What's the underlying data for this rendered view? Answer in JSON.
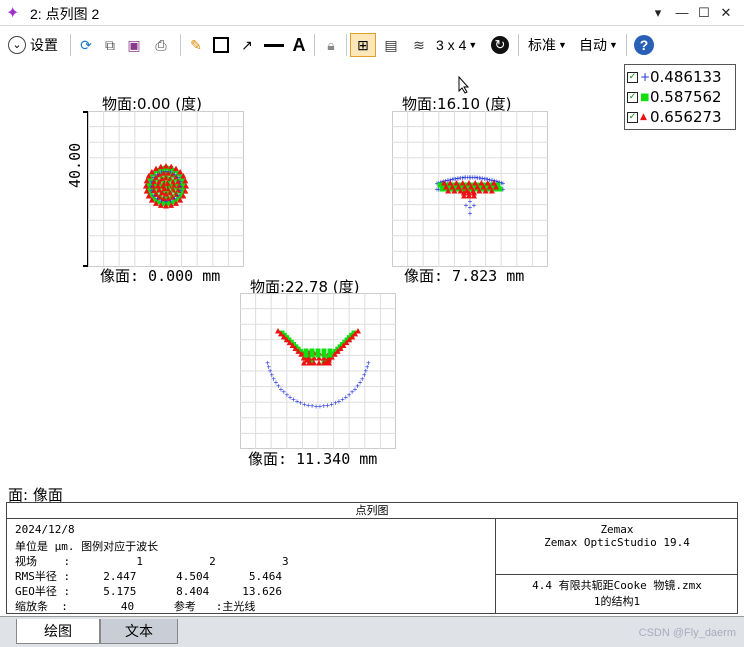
{
  "window": {
    "title": "2: 点列图 2",
    "buttons": [
      "▾",
      "—",
      "☐",
      "✕"
    ]
  },
  "toolbar": {
    "settings_label": "设置",
    "layout_label": "3 x 4",
    "standard_label": "标准",
    "auto_label": "自动"
  },
  "plots": [
    {
      "object_label": "物面:0.00 (度)",
      "image_label": "像面: 0.000 mm"
    },
    {
      "object_label": "物面:16.10 (度)",
      "image_label": "像面: 7.823 mm"
    },
    {
      "object_label": "物面:22.78 (度)",
      "image_label": "像面: 11.340 mm"
    }
  ],
  "scale_bar_label": "40.00",
  "legend": [
    {
      "value": "0.486133",
      "marker": "+",
      "color": "#2233dd"
    },
    {
      "value": "0.587562",
      "marker": "■",
      "color": "#11dd11"
    },
    {
      "value": "0.656273",
      "marker": "▲",
      "color": "#ee1111"
    }
  ],
  "surface_label": "面: 像面",
  "info": {
    "title": "点列图",
    "date": "2024/12/8",
    "units_line": "单位是 μm. 图例对应于波长",
    "field_line": "视场    :          1          2          3",
    "rms_line": "RMS半径 :     2.447      4.504      5.464",
    "geo_line": "GEO半径 :     5.175      8.404     13.626",
    "scale_line": "缩放条  :        40      参考   :主光线",
    "company": "Zemax",
    "product": "Zemax OpticStudio 19.4",
    "file": "4.4 有限共轭距Cooke 物镜.zmx",
    "config": "1的结构1"
  },
  "tabs": [
    "绘图",
    "文本"
  ],
  "watermark": "CSDN @Fly_daerm"
}
